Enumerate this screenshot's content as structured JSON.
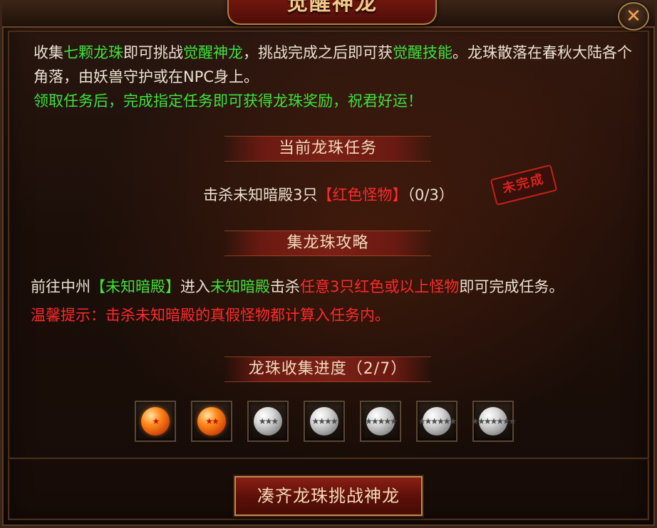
{
  "title": "觉醒神龙",
  "close_label": "✕",
  "intro": {
    "p1": "收集",
    "p1_g1": "七颗龙珠",
    "p2": "即可挑战",
    "p2_g2": "觉醒神龙",
    "p3": "，挑战完成之后即可获",
    "p3_g3": "觉醒技能",
    "p4": "。龙珠散落在春秋大陆各个角落，由妖兽守护或在NPC身上。",
    "line3": "领取任务后，完成指定任务即可获得龙珠奖励，祝君好运！"
  },
  "current_task": {
    "header": "当前龙珠任务",
    "text_before": "击杀未知暗殿3只",
    "text_red": "【红色怪物】",
    "progress": "（0/3）",
    "stamp": "未完成"
  },
  "guide": {
    "header": "集龙珠攻略",
    "l1_a": "前往中州",
    "l1_b": "【未知暗殿】",
    "l1_c": "进入",
    "l1_d": "未知暗殿",
    "l1_e": "击杀",
    "l1_f": "任意3只红色或以上怪物",
    "l1_g": "即可完成任务。",
    "l2": "温馨提示：击杀未知暗殿的真假怪物都计算入任务内。"
  },
  "collection": {
    "header": "龙珠收集进度（2/7）",
    "collected": 2,
    "total": 7,
    "orbs": [
      {
        "stars": "★",
        "state": "collected"
      },
      {
        "stars": "★★",
        "state": "collected"
      },
      {
        "stars": "★★★",
        "state": "uncollected"
      },
      {
        "stars": "★★★★",
        "state": "uncollected"
      },
      {
        "stars": "★★★★★",
        "state": "uncollected"
      },
      {
        "stars": "★★★★★★",
        "state": "uncollected"
      },
      {
        "stars": "★★★★★★★",
        "state": "uncollected"
      }
    ]
  },
  "challenge_button": "凑齐龙珠挑战神龙",
  "colors": {
    "green_text": "#3ee23e",
    "red_text": "#ff2a2a",
    "accent_gold": "#c08a4e"
  }
}
